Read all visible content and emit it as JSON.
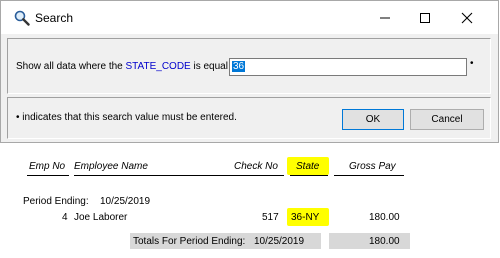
{
  "dialog": {
    "title": "Search",
    "prompt_prefix": "Show all data where the",
    "field_name": "STATE_CODE",
    "prompt_suffix": "is equal to",
    "input_value": "36",
    "required_marker": "•",
    "note": "indicates that this search value must be entered.",
    "ok_label": "OK",
    "cancel_label": "Cancel"
  },
  "report": {
    "headers": {
      "emp_no": "Emp No",
      "employee_name": "Employee Name",
      "check_no": "Check No",
      "state": "State",
      "gross_pay": "Gross Pay"
    },
    "period_label": "Period Ending:",
    "period_date": "10/25/2019",
    "rows": [
      {
        "emp_no": "4",
        "name": "Joe Laborer",
        "check_no": "517",
        "state": "36-NY",
        "gross_pay": "180.00"
      }
    ],
    "totals_label": "Totals For Period Ending:",
    "totals_date": "10/25/2019",
    "totals_gross": "180.00"
  },
  "colors": {
    "highlight": "#ffff00",
    "field_name": "#0000cc",
    "selection": "#0078d7"
  }
}
